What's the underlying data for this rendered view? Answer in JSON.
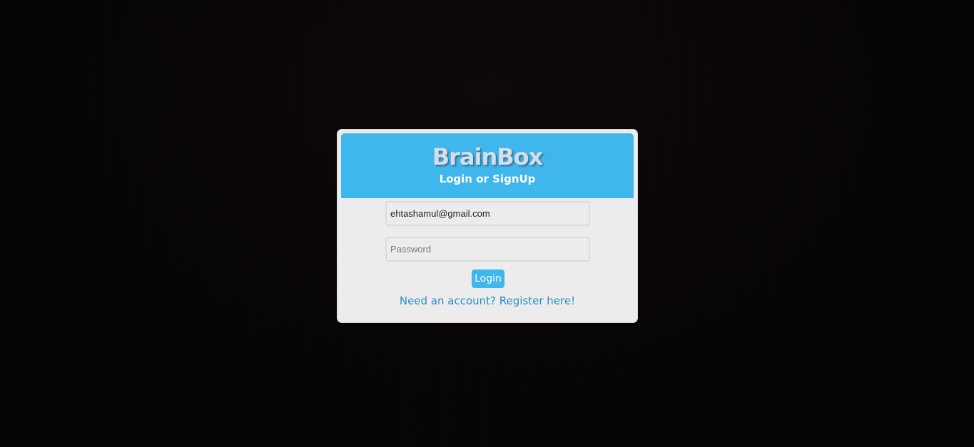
{
  "login_card": {
    "brand": "BrainBox",
    "subtitle": "Login or SignUp",
    "email": {
      "value": "ehtashamul@gmail.com",
      "placeholder": ""
    },
    "password": {
      "value": "",
      "placeholder": "Password"
    },
    "login_label": "Login",
    "register_link": "Need an account? Register here!"
  },
  "colors": {
    "background": "#050303",
    "header": "#3fb6ec",
    "card": "#ececec",
    "link": "#2a8fc6",
    "button": "#3fb6ec"
  }
}
